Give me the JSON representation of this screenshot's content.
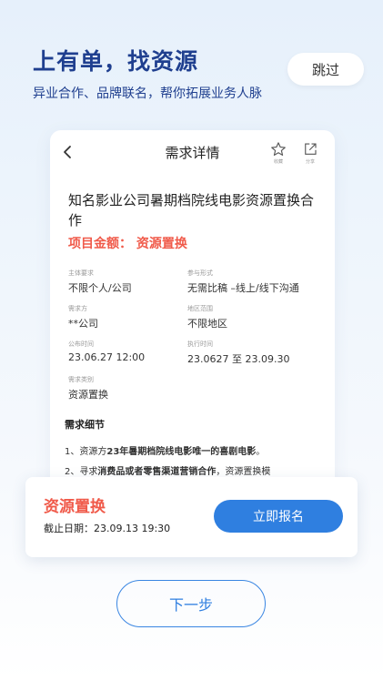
{
  "intro": {
    "headline": "上有单，找资源",
    "subline": "异业合作、品牌联名，帮你拓展业务人脉",
    "skip_label": "跳过",
    "next_label": "下一步"
  },
  "detail": {
    "nav_title": "需求详情",
    "favorite_label": "收藏",
    "share_label": "分享",
    "project_title": "知名影业公司暑期档院线电影资源置换合作",
    "amount": "项目金额：   资源置换",
    "fields": {
      "subject": {
        "label": "主体要求",
        "value": "不限个人/公司"
      },
      "form": {
        "label": "参与形式",
        "value": "无需比稿 –线上/线下沟通"
      },
      "demander": {
        "label": "需求方",
        "value": "**公司"
      },
      "region": {
        "label": "地区范围",
        "value": "不限地区"
      },
      "publish_time": {
        "label": "公布时间",
        "value": "23.06.27 12:00"
      },
      "exec_time": {
        "label": "执行时间",
        "value": "23.0627 至 23.09.30"
      },
      "category": {
        "label": "需求类别",
        "value": "资源置换"
      }
    },
    "details_heading": "需求细节",
    "details_lines": [
      {
        "prefix": "1、资源方",
        "bold": "23年暑期档院线电影唯一的喜剧电影",
        "suffix": "。"
      },
      {
        "prefix": "2、寻求",
        "bold": "消费品或者零售渠道营销合作",
        "suffix": "，资源置换模"
      }
    ]
  },
  "bottom_bar": {
    "type_label": "资源置换",
    "deadline": "截止日期：23.09.13 19:30",
    "signup_label": "立即报名"
  },
  "colors": {
    "headline": "#1f3f8f",
    "accent_red": "#f05a4a",
    "primary_blue": "#2f7fe0"
  }
}
